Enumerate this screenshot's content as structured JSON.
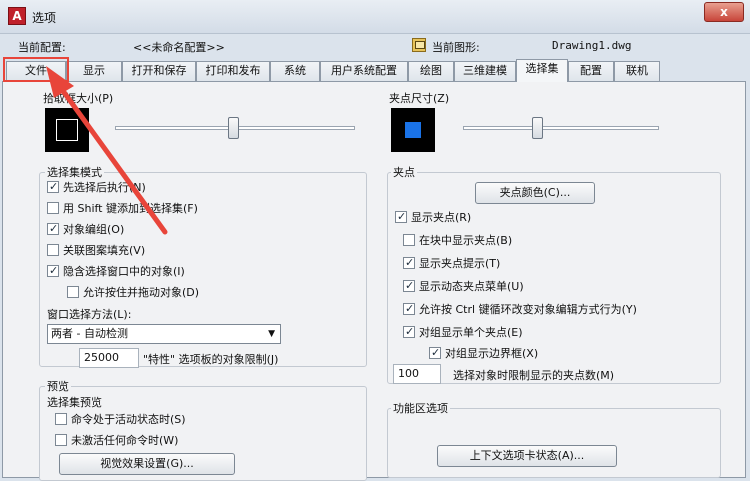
{
  "window": {
    "title": "选项",
    "close_glyph": "x"
  },
  "profile": {
    "current_config_label": "当前配置:",
    "current_config_value": "<<未命名配置>>",
    "current_drawing_label": "当前图形:",
    "current_drawing_value": "Drawing1.dwg"
  },
  "tabs": [
    {
      "label": "文件"
    },
    {
      "label": "显示"
    },
    {
      "label": "打开和保存"
    },
    {
      "label": "打印和发布"
    },
    {
      "label": "系统"
    },
    {
      "label": "用户系统配置"
    },
    {
      "label": "绘图"
    },
    {
      "label": "三维建模"
    },
    {
      "label": "选择集"
    },
    {
      "label": "配置"
    },
    {
      "label": "联机"
    }
  ],
  "active_tab": "选择集",
  "pickbox": {
    "label": "拾取框大小(P)",
    "level": 0.49
  },
  "selection_modes": {
    "label": "选择集模式",
    "items": [
      {
        "label": "先选择后执行(N)",
        "checked": true
      },
      {
        "label": "用 Shift 键添加到选择集(F)",
        "checked": false
      },
      {
        "label": "对象编组(O)",
        "checked": true
      },
      {
        "label": "关联图案填充(V)",
        "checked": false
      },
      {
        "label": "隐含选择窗口中的对象(I)",
        "checked": true
      },
      {
        "label": "允许按住并拖动对象(D)",
        "checked": false
      }
    ],
    "window_method_label": "窗口选择方法(L):",
    "window_method_value": "两者 - 自动检测",
    "limit_value": "25000",
    "limit_label": "\"特性\" 选项板的对象限制(J)"
  },
  "preview": {
    "label": "预览",
    "sub_label": "选择集预览",
    "items": [
      {
        "label": "命令处于活动状态时(S)",
        "checked": false
      },
      {
        "label": "未激活任何命令时(W)",
        "checked": false
      }
    ],
    "effects_button": "视觉效果设置(G)..."
  },
  "grip_size": {
    "label": "夹点尺寸(Z)",
    "level": 0.38
  },
  "grips": {
    "label": "夹点",
    "color_button": "夹点颜色(C)...",
    "items": [
      {
        "label": "显示夹点(R)",
        "checked": true
      },
      {
        "label": "在块中显示夹点(B)",
        "checked": false
      },
      {
        "label": "显示夹点提示(T)",
        "checked": true
      },
      {
        "label": "显示动态夹点菜单(U)",
        "checked": true
      },
      {
        "label": "允许按 Ctrl 键循环改变对象编辑方式行为(Y)",
        "checked": true
      },
      {
        "label": "对组显示单个夹点(E)",
        "checked": true
      },
      {
        "label": "对组显示边界框(X)",
        "checked": true
      }
    ],
    "limit_value": "100",
    "limit_label": "选择对象时限制显示的夹点数(M)"
  },
  "ribbon": {
    "label": "功能区选项",
    "context_button": "上下文选项卡状态(A)..."
  },
  "colors": {
    "highlight": "#e8453a",
    "grip_blue": "#1a73e8"
  }
}
